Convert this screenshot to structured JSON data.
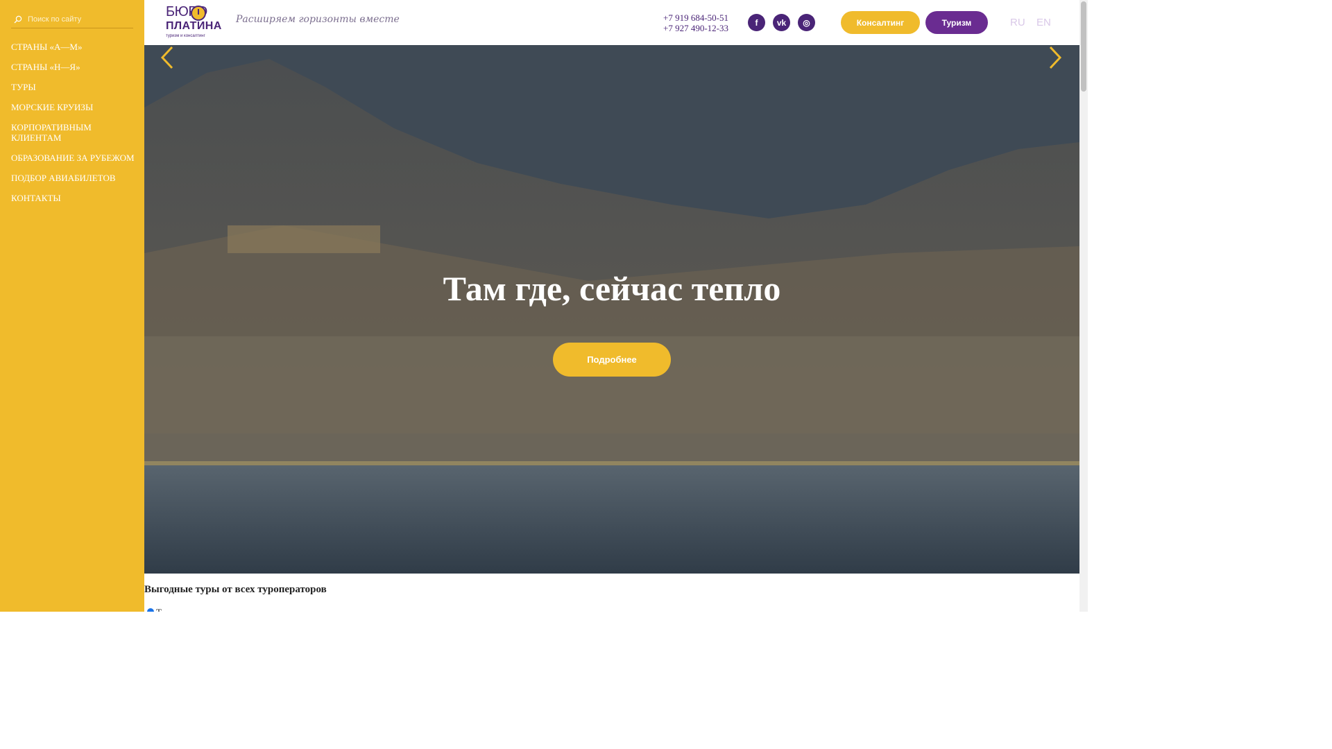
{
  "search": {
    "placeholder": "Поиск по сайту"
  },
  "sidebar": {
    "items": [
      {
        "label": "СТРАНЫ «А—М»"
      },
      {
        "label": "СТРАНЫ «Н—Я»"
      },
      {
        "label": "ТУРЫ"
      },
      {
        "label": "МОРСКИЕ КРУИЗЫ"
      },
      {
        "label": "КОРПОРАТИВНЫМ КЛИЕНТАМ"
      },
      {
        "label": "ОБРАЗОВАНИЕ ЗА РУБЕЖОМ"
      },
      {
        "label": "ПОДБОР АВИАБИЛЕТОВ"
      },
      {
        "label": "КОНТАКТЫ"
      }
    ]
  },
  "header": {
    "logo": {
      "top": "БЮРО",
      "middle": "ПЛАТИНА",
      "sub": "туризм и консалтинг"
    },
    "slogan": "Расширяем горизонты вместе",
    "phones": [
      "+7 919 684-50-51",
      "+7 927 490-12-33"
    ],
    "social": [
      {
        "icon": "facebook-icon",
        "glyph": "f"
      },
      {
        "icon": "vk-icon",
        "glyph": "vk"
      },
      {
        "icon": "instagram-icon",
        "glyph": "◎"
      }
    ],
    "consulting_label": "Консалтинг",
    "tourism_label": "Туризм",
    "lang_ru": "RU",
    "lang_en": "EN"
  },
  "hero": {
    "title": "Там где, сейчас тепло",
    "button_label": "Подробнее",
    "prev_icon": "chevron-left-icon",
    "next_icon": "chevron-right-icon"
  },
  "section": {
    "title": "Выгодные туры от всех туроператоров",
    "radio_label": "Т"
  },
  "colors": {
    "sidebar": "#f0bb2c",
    "brand_purple": "#4a2477",
    "tourism_button": "#6a2c91",
    "accent_yellow": "#f0bb2c"
  }
}
